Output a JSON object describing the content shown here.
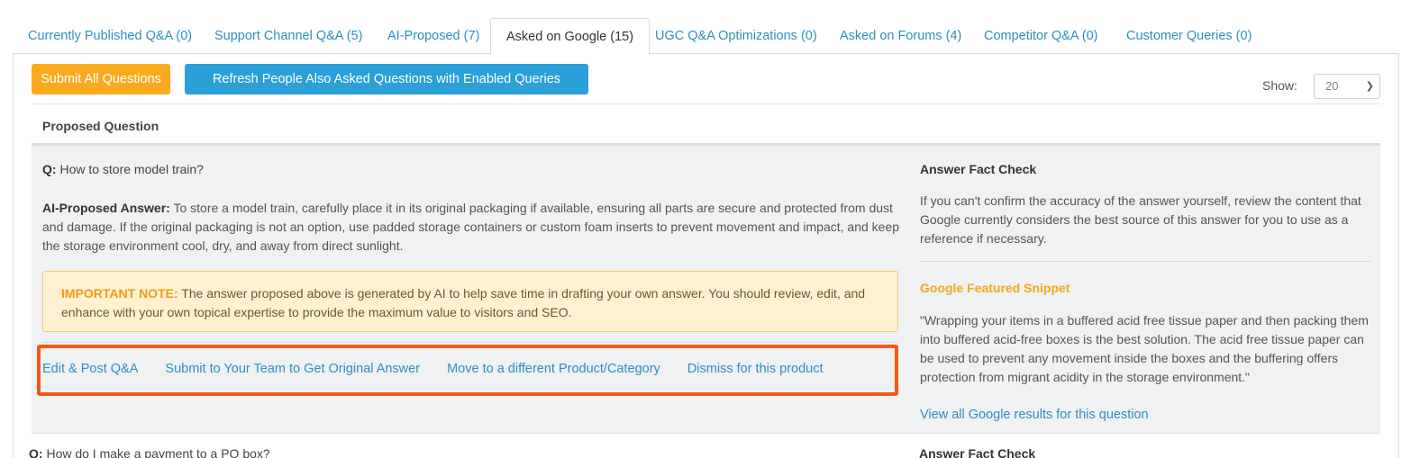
{
  "tabs": [
    {
      "label": "Currently Published Q&A (0)",
      "active": false
    },
    {
      "label": "Support Channel Q&A (5)",
      "active": false
    },
    {
      "label": "AI-Proposed (7)",
      "active": false
    },
    {
      "label": "Asked on Google (15)",
      "active": true
    },
    {
      "label": "UGC Q&A Optimizations (0)",
      "active": false
    },
    {
      "label": "Asked on Forums (4)",
      "active": false
    },
    {
      "label": "Competitor Q&A (0)",
      "active": false
    },
    {
      "label": "Customer Queries (0)",
      "active": false
    }
  ],
  "toolbar": {
    "submit_all_label": "Submit All Questions",
    "refresh_label": "Refresh People Also Asked Questions with Enabled Queries",
    "show_label": "Show:",
    "show_value": "20"
  },
  "table": {
    "header": "Proposed Question"
  },
  "question": {
    "q_prefix": "Q:",
    "q_text": "How to store model train?",
    "answer_prefix": "AI-Proposed Answer:",
    "answer_text": "To store a model train, carefully place it in its original packaging if available, ensuring all parts are secure and protected from dust and damage. If the original packaging is not an option, use padded storage containers or custom foam inserts to prevent movement and impact, and keep the storage environment cool, dry, and away from direct sunlight.",
    "note_prefix": "IMPORTANT NOTE:",
    "note_text": "The answer proposed above is generated by AI to help save time in drafting your own answer. You should review, edit, and enhance with your own topical expertise to provide the maximum value to visitors and SEO.",
    "actions": {
      "edit_post": "Edit & Post Q&A",
      "submit_team": "Submit to Your Team to Get Original Answer",
      "move": "Move to a different Product/Category",
      "dismiss": "Dismiss for this product"
    }
  },
  "fact_check": {
    "heading": "Answer Fact Check",
    "text": "If you can't confirm the accuracy of the answer yourself, review the content that Google currently considers the best source of this answer for you to use as a reference if necessary.",
    "snippet_heading": "Google Featured Snippet",
    "snippet_text": "\"Wrapping your items in a buffered acid free tissue paper and then packing them into buffered acid-free boxes is the best solution. The acid free tissue paper can be used to prevent any movement inside the boxes and the buffering offers protection from migrant acidity in the storage environment.\"",
    "view_all_link": "View all Google results for this question"
  },
  "next_question": {
    "q_prefix": "Q:",
    "q_text": "How do I make a payment to a PO box?",
    "side_heading": "Answer Fact Check"
  },
  "colors": {
    "link": "#2d8fc2",
    "orange_button": "#f9ab1d",
    "blue_button": "#2a9fd8",
    "highlight_border": "#f05a16",
    "note_background": "#fdf1d2",
    "snippet_heading": "#f5a623"
  }
}
